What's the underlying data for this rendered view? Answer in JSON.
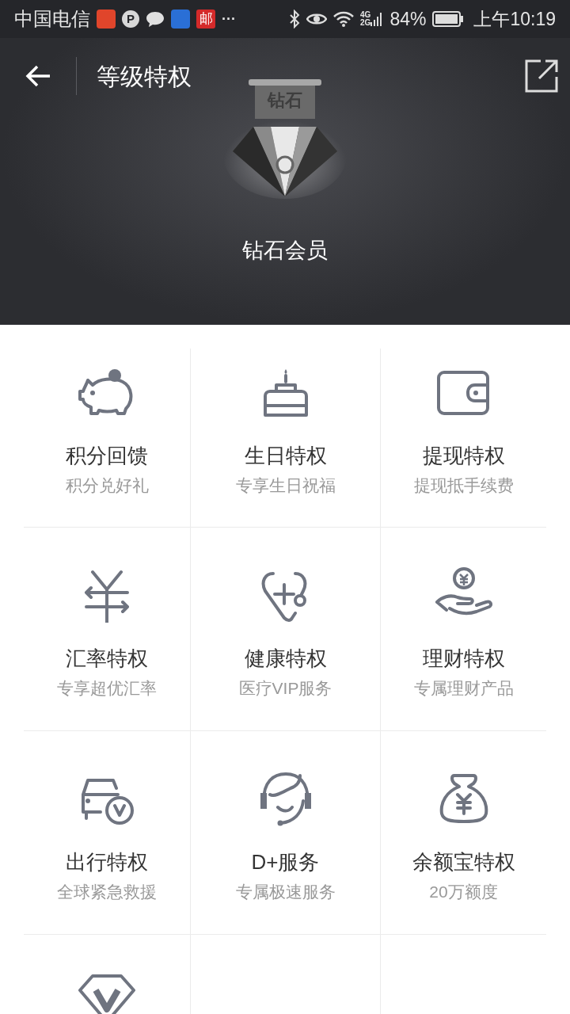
{
  "status_bar": {
    "carrier": "中国电信",
    "notifications": [
      {
        "kind": "app",
        "color": "#e0452b"
      },
      {
        "kind": "letter",
        "text": "P"
      },
      {
        "kind": "chat"
      },
      {
        "kind": "app",
        "color": "#2a6fd6"
      },
      {
        "kind": "letter-box",
        "text": "邮",
        "color": "#d42a2a"
      },
      {
        "kind": "more",
        "text": "···"
      }
    ],
    "network_top": "4G",
    "network_bottom": "2G",
    "battery": "84%",
    "time": "上午10:19"
  },
  "header": {
    "title": "等级特权",
    "badge_text": "钻石",
    "level_name": "钻石会员"
  },
  "privileges": [
    {
      "kind": "full",
      "title": "积分回馈",
      "subtitle": "积分兑好礼"
    },
    {
      "kind": "full",
      "title": "生日特权",
      "subtitle": "专享生日祝福"
    },
    {
      "kind": "full",
      "title": "提现特权",
      "subtitle": "提现抵手续费"
    },
    {
      "kind": "full",
      "title": "汇率特权",
      "subtitle": "专享超优汇率"
    },
    {
      "kind": "full",
      "title": "健康特权",
      "subtitle": "医疗VIP服务"
    },
    {
      "kind": "full",
      "title": "理财特权",
      "subtitle": "专属理财产品"
    },
    {
      "kind": "full",
      "title": "出行特权",
      "subtitle": "全球紧急救援"
    },
    {
      "kind": "full",
      "title": "D+服务",
      "subtitle": "专属极速服务"
    },
    {
      "kind": "full",
      "title": "余额宝特权",
      "subtitle": "20万额度"
    },
    {
      "kind": "icon-only"
    }
  ]
}
